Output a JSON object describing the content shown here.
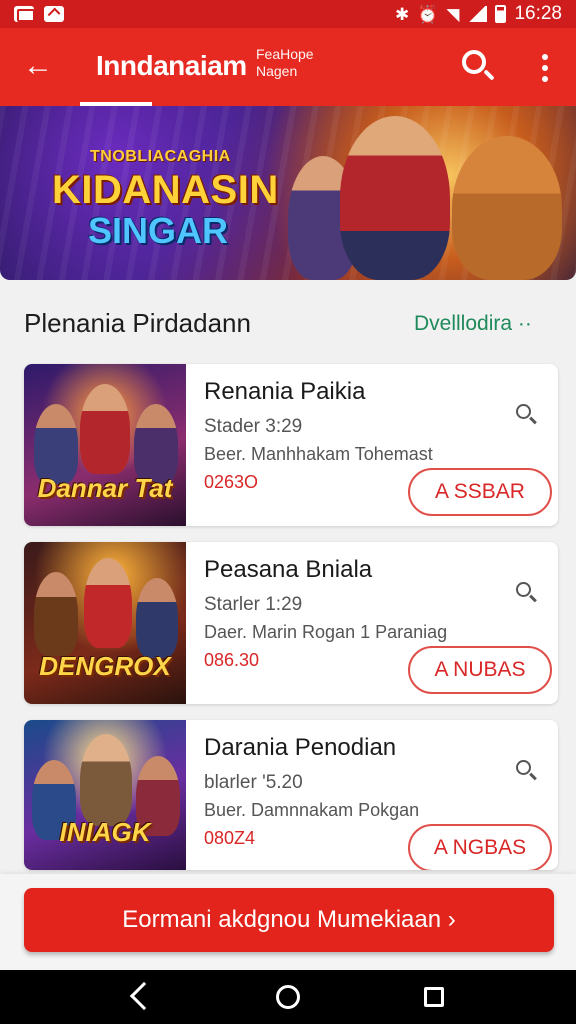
{
  "status_bar": {
    "time": "16:28"
  },
  "app_bar": {
    "title": "Inndanaiam",
    "subtitle_line1": "FeaHope",
    "subtitle_line2": "Nagen"
  },
  "banner": {
    "small_text": "TNOBLIACAGHIA",
    "title_line1": "KIDANASIN",
    "title_line2": "SINGAR"
  },
  "section": {
    "title": "Plenania Pirdadann",
    "link": "Dvelllodira ··"
  },
  "cards": [
    {
      "title": "Renania Paikia",
      "meta": "Stader 3:29",
      "desc": "Beer. Manhhakam Tohemast",
      "price": "0263O",
      "button": "A SSBAR",
      "thumb_label": "Dannar Tat"
    },
    {
      "title": "Peasana Bniala",
      "meta": "Starler 1:29",
      "desc": "Daer. Marin Rogan 1 Paraniag",
      "price": "086.30",
      "button": "A NUBAS",
      "thumb_label": "DENGROX"
    },
    {
      "title": "Darania Penodian",
      "meta": "blarler '5.20",
      "desc": "Buer. Damnnakam Pokgan",
      "price": "080Z4",
      "button": "A NGBAS",
      "thumb_label": "INIAGK"
    }
  ],
  "cta": {
    "label": "Eormani akdgnou Mumekiaan ›"
  }
}
